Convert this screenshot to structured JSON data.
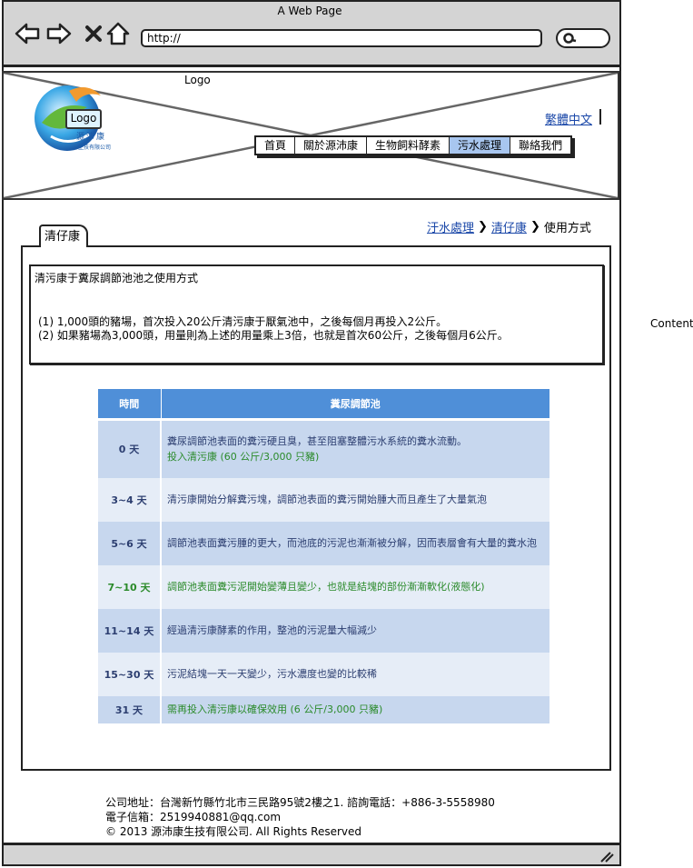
{
  "browser": {
    "title": "A Web Page",
    "url": "http://"
  },
  "header": {
    "logo_label": "Logo",
    "logo_badge": "Logo",
    "logo_cn1": "源沛康",
    "logo_cn2": "生技有限公司",
    "language": "繁體中文",
    "menu": [
      {
        "label": "首頁",
        "active": false
      },
      {
        "label": "關於源沛康",
        "active": false
      },
      {
        "label": "生物飼料酵素",
        "active": false
      },
      {
        "label": "污水處理",
        "active": true
      },
      {
        "label": "聯絡我們",
        "active": false
      }
    ]
  },
  "breadcrumb": {
    "items": [
      "汙水處理",
      "清仔康",
      "使用方式"
    ]
  },
  "tab": {
    "label": "清仔康"
  },
  "intro": {
    "title": "清污康于糞尿調節池池之使用方式",
    "lines": [
      "(1) 1,000頭的豬場，首次投入20公斤清污康于厭氣池中，之後每個月再投入2公斤。",
      "(2) 如果豬場為3,000頭，用量則為上述的用量乘上3倍，也就是首次60公斤，之後每個月6公斤。"
    ]
  },
  "table": {
    "headers": [
      "時間",
      "糞尿調節池"
    ],
    "rows": [
      {
        "time": "0 天",
        "desc": "糞尿調節池表面的糞污硬且臭，甚至阻塞整體污水系統的糞水流動。",
        "desc2": "投入清污康 (60 公斤/3,000 只豬)",
        "green": false
      },
      {
        "time": "3~4 天",
        "desc": "清污康開始分解糞污塊，調節池表面的糞污開始腫大而且產生了大量氣泡",
        "desc2": "",
        "green": false
      },
      {
        "time": "5~6 天",
        "desc": "調節池表面糞污腫的更大，而池底的污泥也漸漸被分解，因而表層會有大量的糞水泡",
        "desc2": "",
        "green": false
      },
      {
        "time": "7~10 天",
        "desc": "調節池表面糞污泥開始變薄且變少，也就是結塊的部份漸漸軟化(液態化)",
        "desc2": "",
        "green": true
      },
      {
        "time": "11~14 天",
        "desc": "經過清污康酵素的作用，整池的污泥量大幅減少",
        "desc2": "",
        "green": false
      },
      {
        "time": "15~30 天",
        "desc": "污泥結塊一天一天變少，污水濃度也變的比較稀",
        "desc2": "",
        "green": false
      },
      {
        "time": "31 天",
        "desc": "需再投入清污康以確保效用 (6 公斤/3,000 只豬)",
        "desc2": "",
        "green": true
      }
    ],
    "colors": {
      "header": "#4f8fd8",
      "row_dark": "#c7d7ee",
      "row_light": "#e6edf7"
    }
  },
  "footer": {
    "address": "公司地址：台灣新竹縣竹北市三民路95號2樓之1. 諮詢電話：+886-3-5558980",
    "email": "電子信箱：2519940881@qq.com",
    "copyright": "© 2013 源沛康生技有限公司. All Rights Reserved"
  },
  "side_label": "Content"
}
